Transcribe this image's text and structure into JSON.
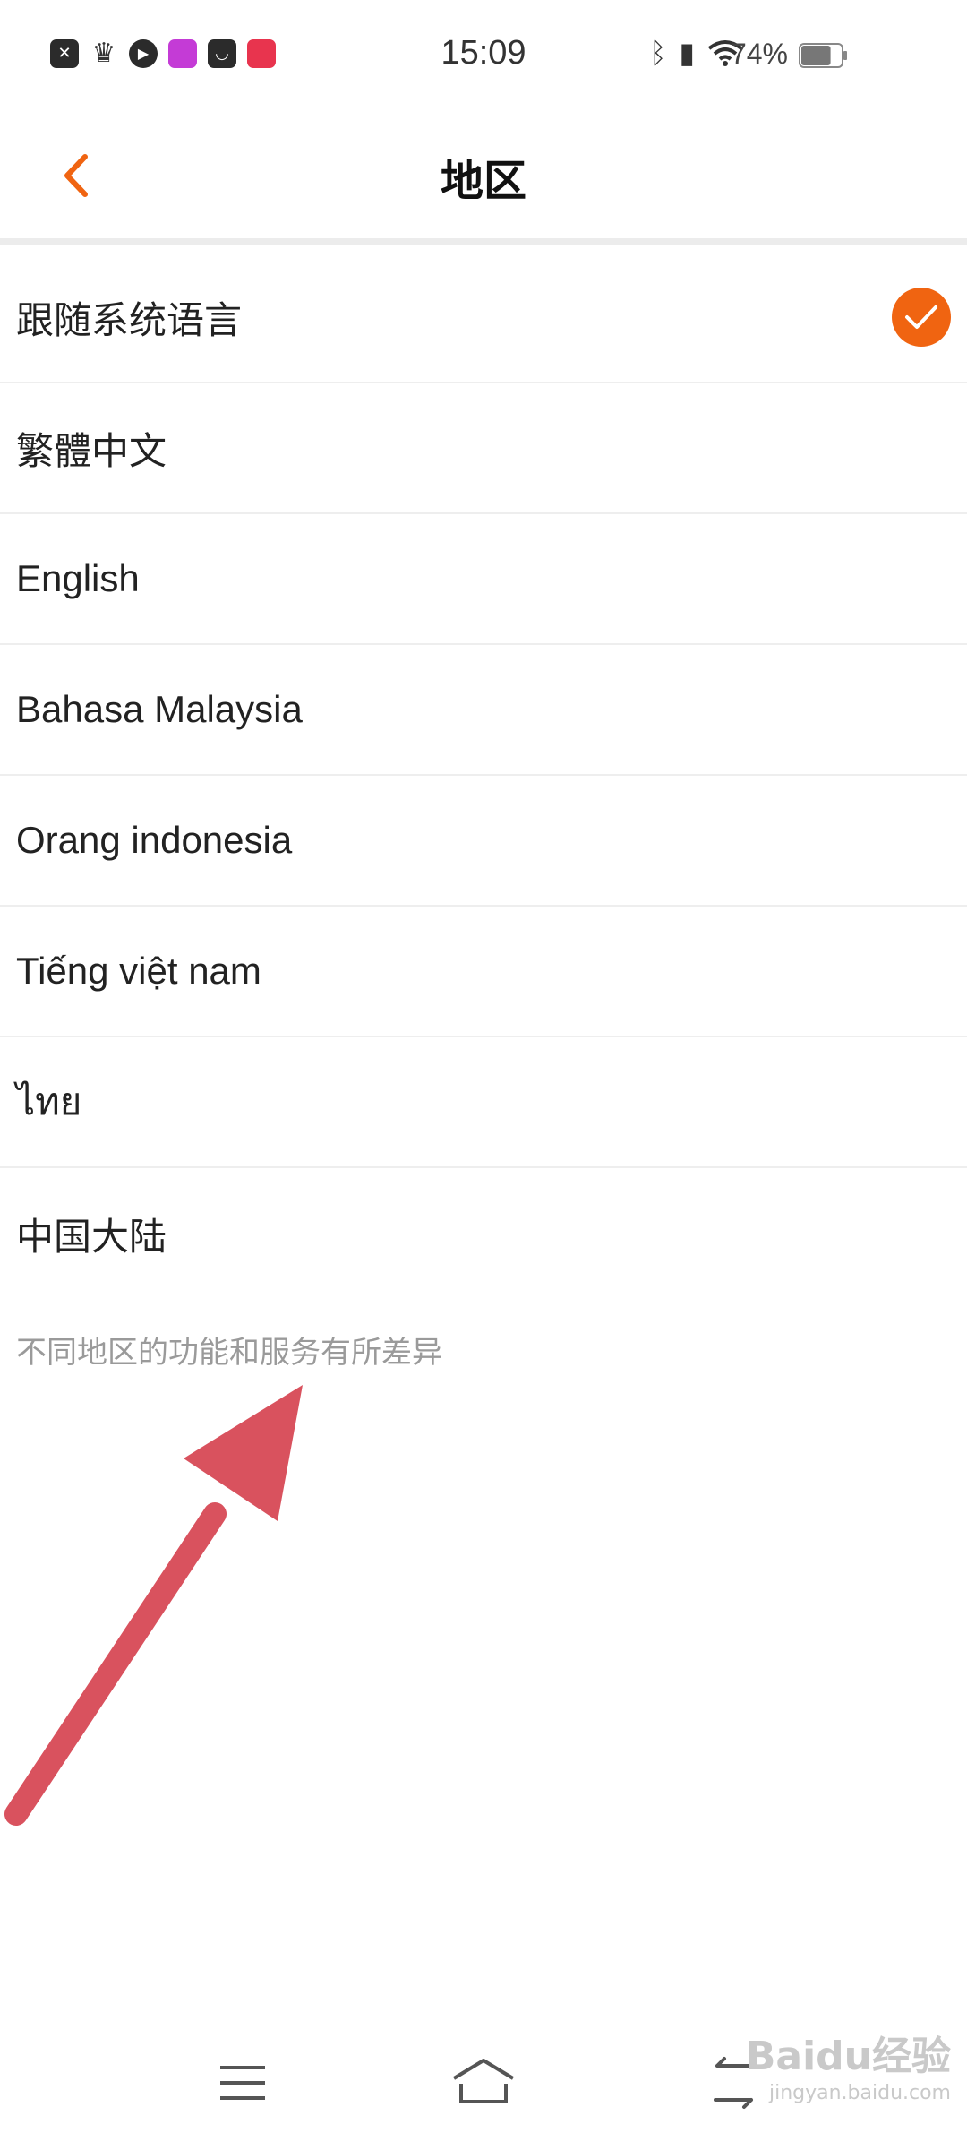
{
  "status_bar": {
    "time": "15:09",
    "battery_percent": "74%",
    "battery_level": 0.74,
    "notification_icons": [
      "close-app-icon",
      "crown-icon",
      "play-icon",
      "app-icon-pink",
      "bag-icon",
      "app-icon-red"
    ]
  },
  "header": {
    "title": "地区",
    "back_icon": "chevron-left-icon"
  },
  "options": [
    {
      "label": "跟随系统语言",
      "selected": true
    },
    {
      "label": "繁體中文",
      "selected": false
    },
    {
      "label": "English",
      "selected": false
    },
    {
      "label": "Bahasa Malaysia",
      "selected": false
    },
    {
      "label": "Orang indonesia",
      "selected": false
    },
    {
      "label": "Tiếng việt nam",
      "selected": false
    },
    {
      "label": "ไทย",
      "selected": false
    },
    {
      "label": "中国大陆",
      "selected": false
    }
  ],
  "footnote": "不同地区的功能和服务有所差异",
  "colors": {
    "accent": "#f06411",
    "annotation_arrow": "#d9525e",
    "divider": "#eeeeee",
    "footnote_text": "#9a9a9a"
  },
  "nav_bar": {
    "icons": [
      "menu-icon",
      "home-icon",
      "back-icon"
    ]
  },
  "watermark": {
    "brand": "Baidu经验",
    "url": "jingyan.baidu.com"
  }
}
